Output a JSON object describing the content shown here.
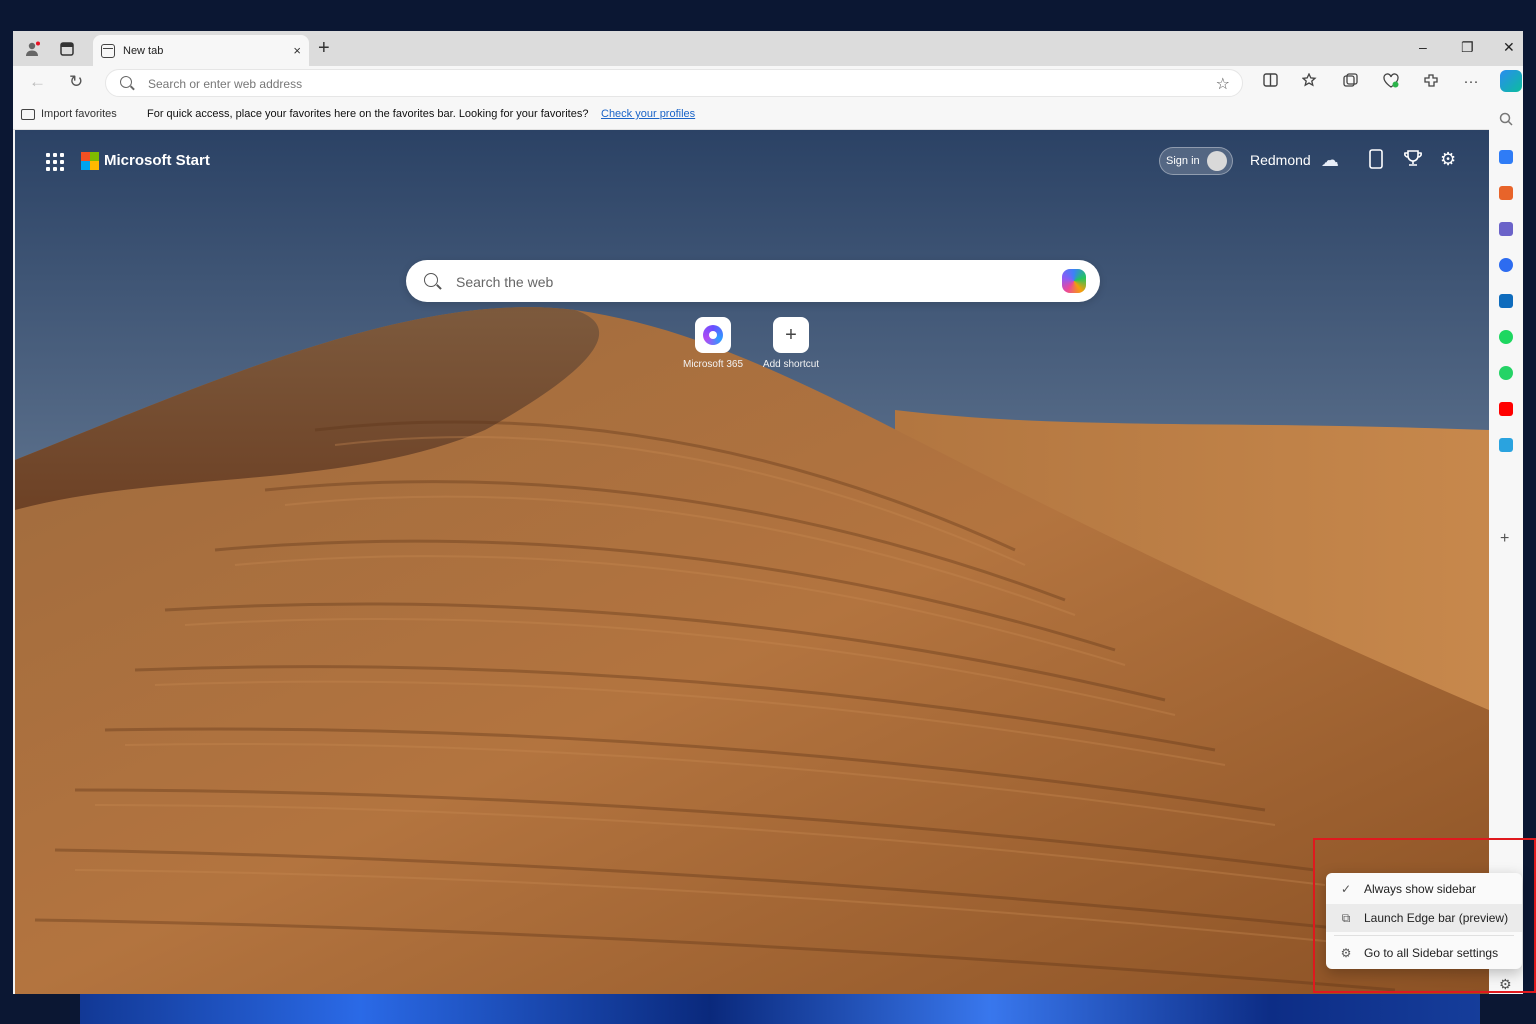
{
  "tab": {
    "title": "New tab",
    "close": "×"
  },
  "new_tab": "+",
  "window_controls": {
    "minimize": "–",
    "restore": "❐",
    "close": "✕"
  },
  "toolbar": {
    "back": "←",
    "refresh": "↻",
    "address_placeholder": "Search or enter web address",
    "star": "☆",
    "more": "···",
    "icons": [
      "split-screen-icon",
      "favorites-icon",
      "collections-icon",
      "browser-essentials-icon",
      "extensions-icon",
      "more-icon",
      "copilot-icon"
    ]
  },
  "favorites_bar": {
    "import_label": "Import favorites",
    "message": "For quick access, place your favorites here on the favorites bar. Looking for your favorites?",
    "link": "Check your profiles"
  },
  "start_page": {
    "brand": "Microsoft Start",
    "sign_in": "Sign in",
    "location": "Redmond",
    "search_placeholder": "Search the web",
    "shortcuts": [
      {
        "label": "Microsoft 365"
      },
      {
        "label": "Add shortcut",
        "glyph": "+"
      }
    ]
  },
  "sidebar": {
    "add": "+",
    "gear": "⚙",
    "icons": [
      {
        "name": "search-icon",
        "color": "#777777"
      },
      {
        "name": "tag-icon",
        "color": "#2f7cf6"
      },
      {
        "name": "briefcase-icon",
        "color": "#e8642a"
      },
      {
        "name": "people-icon",
        "color": "#6b63c9"
      },
      {
        "name": "m365-icon",
        "color": "#2d6cf0"
      },
      {
        "name": "outlook-icon",
        "color": "#0f6cbd"
      },
      {
        "name": "spotify-icon",
        "color": "#1ed760"
      },
      {
        "name": "whatsapp-icon",
        "color": "#25d366"
      },
      {
        "name": "youtube-icon",
        "color": "#ff0000"
      },
      {
        "name": "telegram-icon",
        "color": "#2aa3df"
      }
    ]
  },
  "sidebar_menu": {
    "items": [
      {
        "label": "Always show sidebar",
        "glyph": "✓"
      },
      {
        "label": "Launch Edge bar (preview)",
        "glyph": "⧉"
      },
      {
        "label": "Go to all Sidebar settings",
        "glyph": "⚙"
      }
    ]
  },
  "highlight_color": "#e0191e"
}
